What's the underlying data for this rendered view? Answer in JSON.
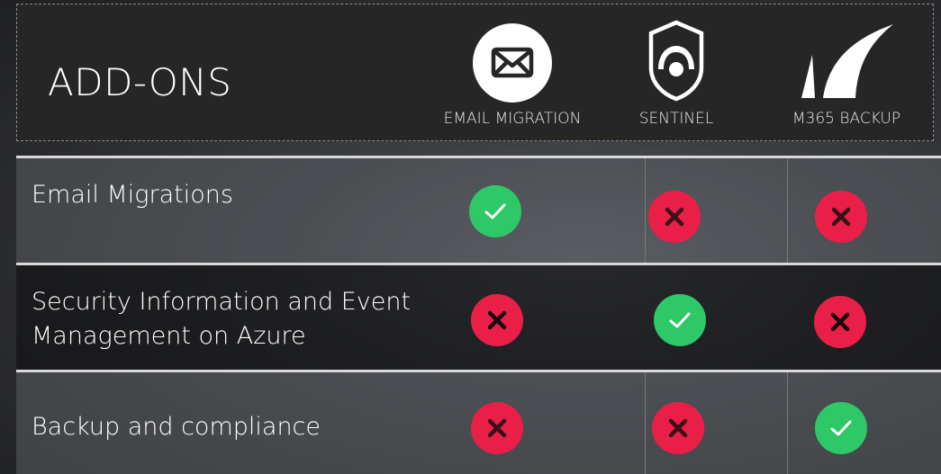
{
  "header": {
    "title": "ADD-ONS"
  },
  "products": [
    {
      "key": "email-migration",
      "label": "EMAIL MIGRATION",
      "icon": "envelope-icon"
    },
    {
      "key": "sentinel",
      "label": "SENTINEL",
      "icon": "shield-eye-icon"
    },
    {
      "key": "m365-backup",
      "label": "M365 BACKUP",
      "icon": "fin-logo-icon"
    }
  ],
  "rows": [
    {
      "label": "Email Migrations",
      "values": [
        true,
        false,
        false
      ]
    },
    {
      "label": "Security Information and Event Management on Azure",
      "values": [
        false,
        true,
        false
      ]
    },
    {
      "label": "Backup and compliance",
      "values": [
        false,
        false,
        true
      ]
    }
  ],
  "colors": {
    "yes": "#2ec866",
    "no": "#ea1f48",
    "header_bg": "#262626"
  }
}
